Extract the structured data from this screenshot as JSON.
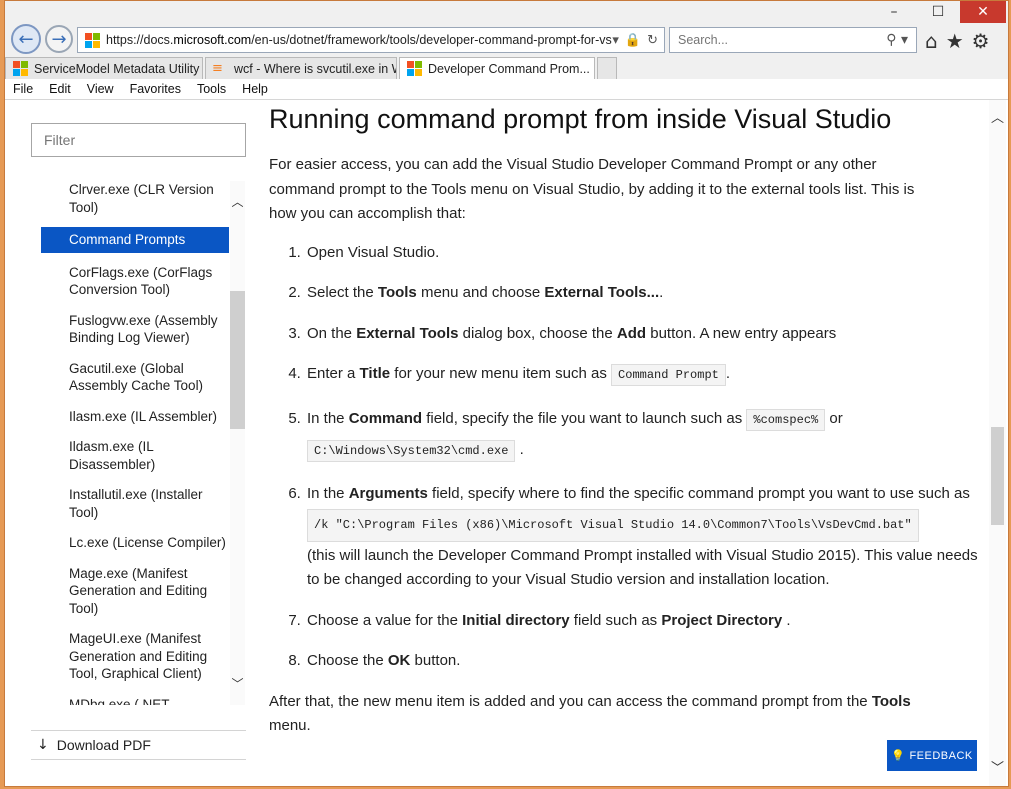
{
  "window": {
    "controls": {
      "minimize": "–",
      "maximize": "☐",
      "close": "✕"
    }
  },
  "nav": {
    "back_glyph": "←",
    "forward_glyph": "→",
    "url_prefix": "https://docs.",
    "url_host": "microsoft.com",
    "url_path": "/en-us/dotnet/framework/tools/developer-command-prompt-for-vs",
    "search_placeholder": "Search...",
    "icons": [
      "home-icon",
      "favorites-star-icon",
      "settings-gear-icon"
    ]
  },
  "tabs": [
    {
      "label": "ServiceModel Metadata Utility ...",
      "icon": "ms-logo-icon",
      "active": false
    },
    {
      "label": "wcf - Where is svcutil.exe in Wi...",
      "icon": "stackoverflow-icon",
      "active": false
    },
    {
      "label": "Developer Command Prom...",
      "icon": "ms-logo-icon",
      "active": true,
      "close": "✕"
    }
  ],
  "menubar": [
    "File",
    "Edit",
    "View",
    "Favorites",
    "Tools",
    "Help"
  ],
  "sidebar": {
    "filter_placeholder": "Filter",
    "items": [
      {
        "label": "Clrver.exe (CLR Version Tool)",
        "active": false
      },
      {
        "label": "Command Prompts",
        "active": true
      },
      {
        "label": "CorFlags.exe (CorFlags Conversion Tool)",
        "active": false
      },
      {
        "label": "Fuslogvw.exe (Assembly Binding Log Viewer)",
        "active": false
      },
      {
        "label": "Gacutil.exe (Global Assembly Cache Tool)",
        "active": false
      },
      {
        "label": "Ilasm.exe (IL Assembler)",
        "active": false
      },
      {
        "label": "Ildasm.exe (IL Disassembler)",
        "active": false
      },
      {
        "label": "Installutil.exe (Installer Tool)",
        "active": false
      },
      {
        "label": "Lc.exe (License Compiler)",
        "active": false
      },
      {
        "label": "Mage.exe (Manifest Generation and Editing Tool)",
        "active": false
      },
      {
        "label": "MageUI.exe (Manifest Generation and Editing Tool, Graphical Client)",
        "active": false
      },
      {
        "label": "MDbg.exe (.NET Framework Command-Line Debugger)",
        "active": false
      }
    ],
    "download_label": "Download PDF"
  },
  "article": {
    "heading": "Running command prompt from inside Visual Studio",
    "intro": "For easier access, you can add the Visual Studio Developer Command Prompt or any other command prompt to the Tools menu on Visual Studio, by adding it to the external tools list. This is how you can accomplish that:",
    "steps": {
      "s1": "Open Visual Studio.",
      "s2a": "Select the ",
      "s2b": "Tools",
      "s2c": " menu and choose ",
      "s2d": "External Tools...",
      "s2e": ".",
      "s3a": "On the ",
      "s3b": "External Tools",
      "s3c": " dialog box, choose the ",
      "s3d": "Add",
      "s3e": " button. A new entry appears",
      "s4a": "Enter a ",
      "s4b": "Title",
      "s4c": " for your new menu item such as ",
      "s4code": "Command Prompt",
      "s4e": ".",
      "s5a": "In the ",
      "s5b": "Command",
      "s5c": " field, specify the file you want to launch such as ",
      "s5code1": "%comspec%",
      "s5d": " or",
      "s5code2": "C:\\Windows\\System32\\cmd.exe",
      "s5e": " .",
      "s6a": "In the ",
      "s6b": "Arguments",
      "s6c": " field, specify where to find the specific command prompt you want to use such as",
      "s6code": "/k \"C:\\Program Files (x86)\\Microsoft Visual Studio 14.0\\Common7\\Tools\\VsDevCmd.bat\"",
      "s6d": "(this will launch the Developer Command Prompt installed with Visual Studio 2015). This value needs to be changed according to your Visual Studio version and installation location.",
      "s7a": "Choose a value for the ",
      "s7b": "Initial directory",
      "s7c": " field such as ",
      "s7d": "Project Directory",
      "s7e": " .",
      "s8a": "Choose the ",
      "s8b": "OK",
      "s8c": " button."
    },
    "outro_a": "After that, the new menu item is added and you can access the command prompt from the ",
    "outro_b": "Tools",
    "outro_c": " menu."
  },
  "feedback_label": "FEEDBACK",
  "colors": {
    "accent": "#0a56c4",
    "window_frame": "#e69a55",
    "close": "#c8392d"
  }
}
